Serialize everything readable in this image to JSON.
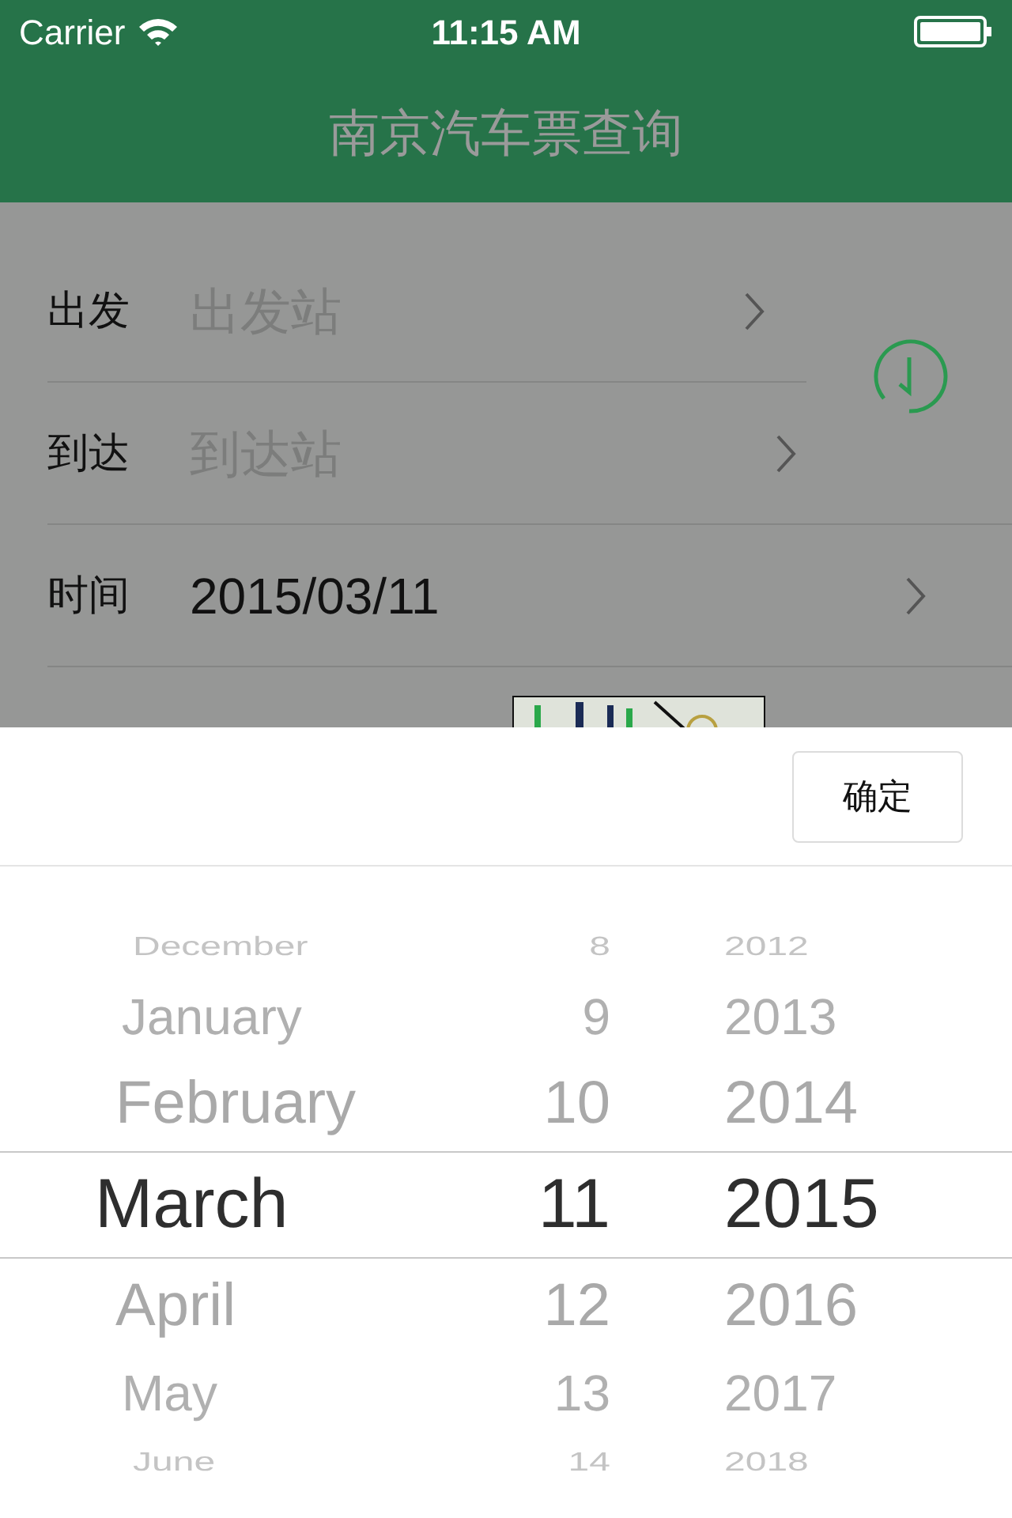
{
  "status_bar": {
    "carrier": "Carrier",
    "time": "11:15 AM"
  },
  "header": {
    "title": "南京汽车票查询"
  },
  "form": {
    "rows": [
      {
        "label": "出发",
        "placeholder": "出发站",
        "kind": "select"
      },
      {
        "label": "到达",
        "placeholder": "到达站",
        "kind": "select"
      },
      {
        "label": "时间",
        "value": "2015/03/11",
        "kind": "select"
      }
    ]
  },
  "toolbar": {
    "confirm": "确定"
  },
  "picker": {
    "rows": [
      {
        "month": "December",
        "day": "8",
        "year": "2012",
        "selected": false
      },
      {
        "month": "January",
        "day": "9",
        "year": "2013",
        "selected": false
      },
      {
        "month": "February",
        "day": "10",
        "year": "2014",
        "selected": false
      },
      {
        "month": "March",
        "day": "11",
        "year": "2015",
        "selected": true
      },
      {
        "month": "April",
        "day": "12",
        "year": "2016",
        "selected": false
      },
      {
        "month": "May",
        "day": "13",
        "year": "2017",
        "selected": false
      },
      {
        "month": "June",
        "day": "14",
        "year": "2018",
        "selected": false
      }
    ]
  }
}
